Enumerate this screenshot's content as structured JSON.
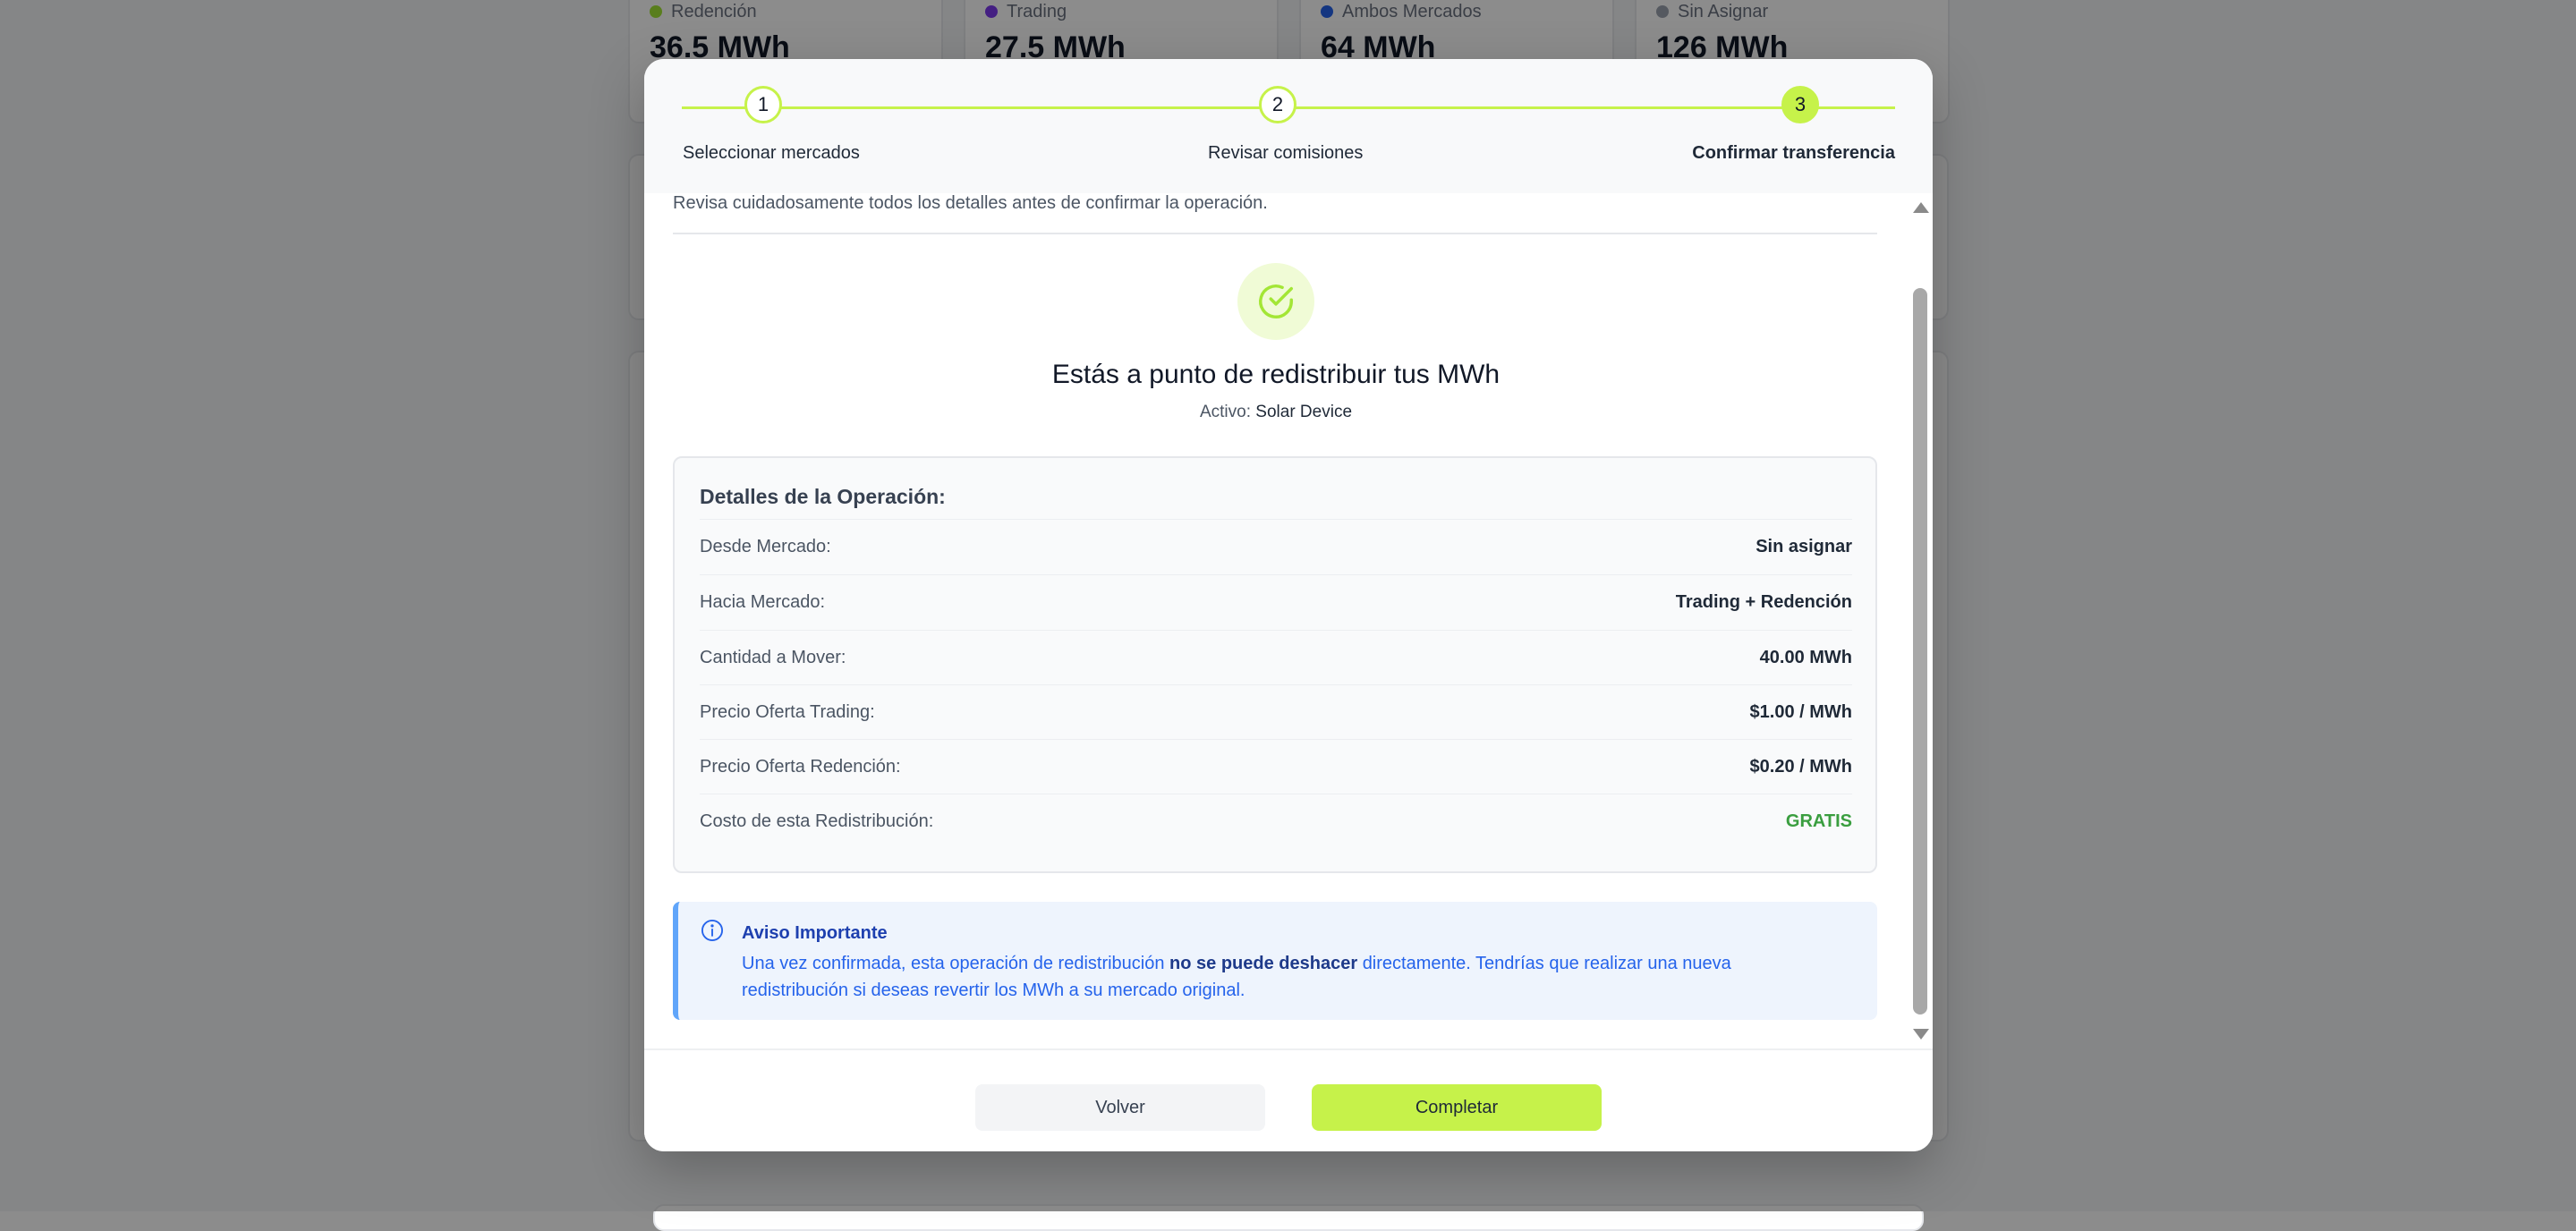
{
  "background": {
    "stats": [
      {
        "label": "Redención",
        "value": "36.5 MWh",
        "color": "#a3e635"
      },
      {
        "label": "Trading",
        "value": "27.5 MWh",
        "color": "#7c3aed"
      },
      {
        "label": "Ambos Mercados",
        "value": "64 MWh",
        "color": "#2563eb"
      },
      {
        "label": "Sin Asignar",
        "value": "126 MWh",
        "color": "#9ca3af"
      }
    ]
  },
  "stepper": {
    "steps": [
      {
        "number": "1",
        "label": "Seleccionar mercados"
      },
      {
        "number": "2",
        "label": "Revisar comisiones"
      },
      {
        "number": "3",
        "label": "Confirmar transferencia"
      }
    ],
    "active_step": 3,
    "accent_color": "#c6f24a"
  },
  "content": {
    "intro": "Revisa cuidadosamente todos los detalles antes de confirmar la operación.",
    "heading": "Estás a punto de redistribuir tus MWh",
    "asset_label": "Activo:",
    "asset_value": "Solar Device",
    "icon": "check-circle-icon"
  },
  "details": {
    "title": "Detalles de la Operación:",
    "rows": [
      {
        "label": "Desde Mercado:",
        "value": "Sin asignar"
      },
      {
        "label": "Hacia Mercado:",
        "value": "Trading + Redención"
      },
      {
        "label": "Cantidad a Mover:",
        "value": "40.00 MWh"
      },
      {
        "label": "Precio Oferta Trading:",
        "value": "$1.00 / MWh"
      },
      {
        "label": "Precio Oferta Redención:",
        "value": "$0.20 / MWh"
      },
      {
        "label": "Costo de esta Redistribución:",
        "value": "GRATIS"
      }
    ]
  },
  "notice": {
    "icon": "info-icon",
    "title": "Aviso Importante",
    "text_before": "Una vez confirmada, esta operación de redistribución",
    "text_bold": "no se puede deshacer",
    "text_after": "directamente. Tendrías que realizar una nueva redistribución si deseas revertir los MWh a su mercado original."
  },
  "footer": {
    "back_label": "Volver",
    "complete_label": "Completar"
  }
}
